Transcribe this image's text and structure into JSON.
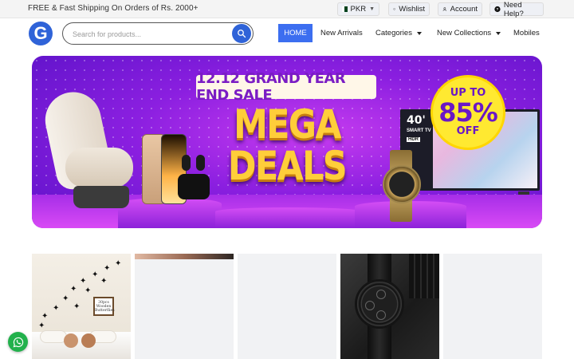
{
  "topbar": {
    "promo": "FREE & Fast Shipping On Orders of Rs. 2000+",
    "currency": "PKR",
    "wishlist": "Wishlist",
    "account": "Account",
    "help": "Need Help?"
  },
  "header": {
    "logo_letter": "G",
    "search_placeholder": "Search for products...",
    "nav": {
      "home": "HOME",
      "new_arrivals": "New Arrivals",
      "categories": "Categories",
      "new_collections": "New Collections",
      "mobiles": "Mobiles"
    }
  },
  "banner": {
    "sale_title": "12.12 GRAND YEAR END SALE",
    "headline_line1": "MEGA",
    "headline_line2": "DEALS",
    "badge_top": "UP TO",
    "badge_percent": "85%",
    "badge_bottom": "OFF",
    "tv_size": "40'",
    "tv_label": "SMART TV",
    "tv_hdr": "HDR"
  },
  "products": {
    "card1_frame_text": "30pcs Wooden Butterflies"
  },
  "icons": {
    "heart": "heart-icon",
    "user": "user-icon",
    "help": "help-icon",
    "search": "search-icon",
    "whatsapp": "whatsapp-icon",
    "flag": "pakistan-flag-icon"
  },
  "colors": {
    "accent": "#3c6ef0",
    "banner_purple": "#8b1fe0",
    "badge_yellow": "#ffe931",
    "whatsapp_green": "#22b14c"
  }
}
